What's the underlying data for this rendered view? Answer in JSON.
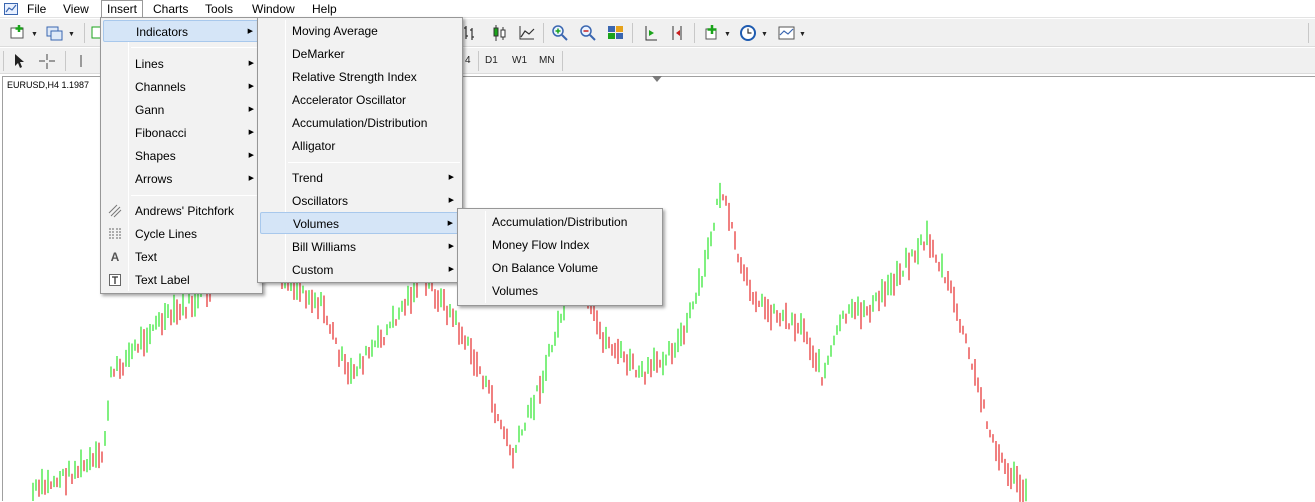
{
  "menubar": {
    "items": [
      "File",
      "View",
      "Insert",
      "Charts",
      "Tools",
      "Window",
      "Help"
    ],
    "open_item": "Insert"
  },
  "toolbar2": {
    "timeframes": [
      "4",
      "D1",
      "W1",
      "MN"
    ]
  },
  "chart": {
    "label": "EURUSD,H4  1.1987",
    "bull_color": "#00e000",
    "bear_color": "#e00000"
  },
  "insert_menu": {
    "items": [
      "Indicators",
      "Lines",
      "Channels",
      "Gann",
      "Fibonacci",
      "Shapes",
      "Arrows",
      "Andrews' Pitchfork",
      "Cycle Lines",
      "Text",
      "Text Label"
    ]
  },
  "indicators_menu": {
    "items": [
      "Moving Average",
      "DeMarker",
      "Relative Strength Index",
      "Accelerator Oscillator",
      "Accumulation/Distribution",
      "Alligator",
      "Trend",
      "Oscillators",
      "Volumes",
      "Bill Williams",
      "Custom"
    ]
  },
  "volumes_menu": {
    "items": [
      "Accumulation/Distribution",
      "Money Flow Index",
      "On Balance Volume",
      "Volumes"
    ]
  },
  "icons": {
    "app": "chart-app-icon",
    "pitchfork": "pitchfork-icon",
    "cycle": "cycle-lines-icon",
    "text": "text-icon",
    "text_label": "text-label-icon"
  },
  "colors": {
    "menu_highlight": "#d5e5f7",
    "menu_background": "#f2f2f2"
  }
}
